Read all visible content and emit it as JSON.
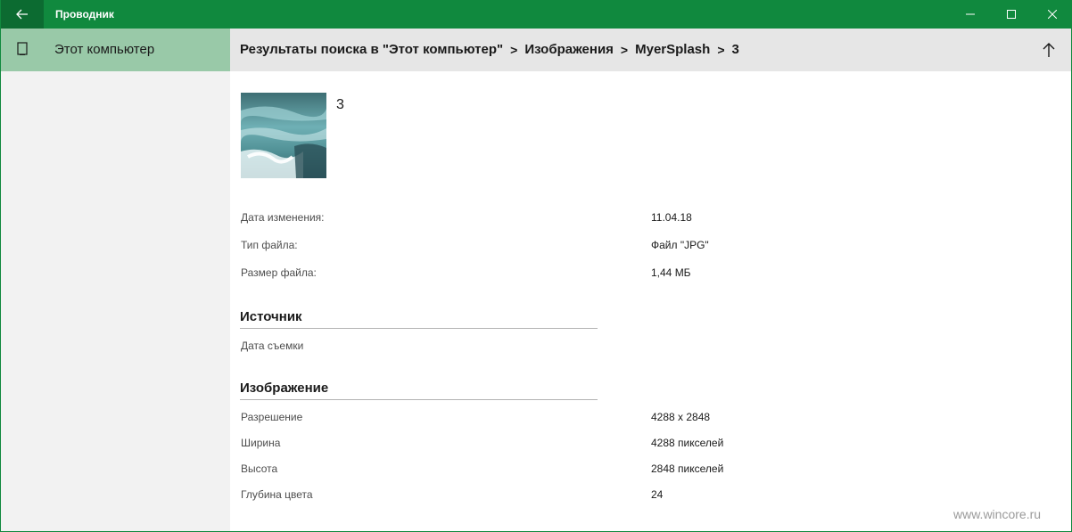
{
  "titlebar": {
    "app_title": "Проводник",
    "back_icon": "arrow-left-icon",
    "color": "#10893e"
  },
  "sidebar": {
    "items": [
      {
        "label": "Этот компьютер",
        "icon": "computer-icon",
        "selected": true
      }
    ]
  },
  "breadcrumb": {
    "items": [
      "Результаты поиска в \"Этот компьютер\"",
      "Изображения",
      "MyerSplash",
      "3"
    ],
    "separator": ">"
  },
  "file": {
    "name": "3",
    "thumbnail_icon": "image-thumbnail"
  },
  "properties": [
    {
      "label": "Дата изменения:",
      "value": "11.04.18"
    },
    {
      "label": "Тип файла:",
      "value": "Файл \"JPG\""
    },
    {
      "label": "Размер файла:",
      "value": "1,44 МБ"
    }
  ],
  "source": {
    "title": "Источник",
    "rows": [
      {
        "label": "Дата съемки",
        "value": ""
      }
    ]
  },
  "image": {
    "title": "Изображение",
    "rows": [
      {
        "label": "Разрешение",
        "value": "4288 x 2848"
      },
      {
        "label": "Ширина",
        "value": "4288 пикселей"
      },
      {
        "label": "Высота",
        "value": "2848 пикселей"
      },
      {
        "label": "Глубина цвета",
        "value": "24"
      }
    ]
  },
  "watermark": "www.wincore.ru"
}
